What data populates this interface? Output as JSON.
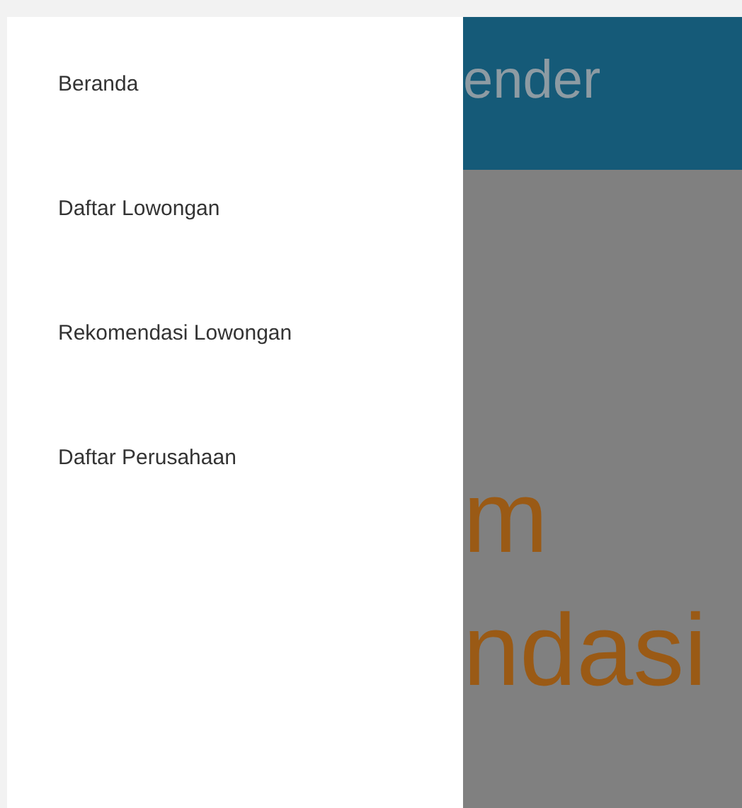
{
  "drawer": {
    "items": [
      {
        "label": "Beranda"
      },
      {
        "label": "Daftar Lowongan"
      },
      {
        "label": "Rekomendasi Lowongan"
      },
      {
        "label": "Daftar Perusahaan"
      }
    ]
  },
  "header": {
    "title": "ender"
  },
  "content": {
    "heading_lines": [
      "m",
      "ndasi"
    ]
  }
}
